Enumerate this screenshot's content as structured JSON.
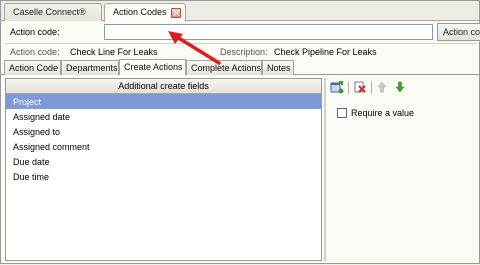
{
  "doc_tabs": [
    {
      "label": "Caselle Connect®"
    },
    {
      "label": "Action Codes"
    }
  ],
  "search": {
    "label": "Action code:",
    "value": "",
    "button_label": "Action code"
  },
  "info": {
    "action_code_label": "Action code:",
    "action_code_value": "Check Line For Leaks",
    "description_label": "Description:",
    "description_value": "Check Pipeline For Leaks"
  },
  "inner_tabs": [
    {
      "label": "Action Code"
    },
    {
      "label": "Departments"
    },
    {
      "label": "Create Actions"
    },
    {
      "label": "Complete Actions"
    },
    {
      "label": "Notes"
    }
  ],
  "grid": {
    "header": "Additional create fields",
    "rows": [
      "Project",
      "Assigned date",
      "Assigned to",
      "Assigned comment",
      "Due date",
      "Due time"
    ],
    "selected_index": 0
  },
  "toolbar_icons": [
    "add-field-icon",
    "delete-icon",
    "move-up-icon",
    "move-down-icon"
  ],
  "require_value": {
    "label": "Require a value",
    "checked": false
  },
  "colors": {
    "selection": "#7e99d6",
    "annotation_arrow": "#e21b1b",
    "close_button": "#e48b7d"
  }
}
